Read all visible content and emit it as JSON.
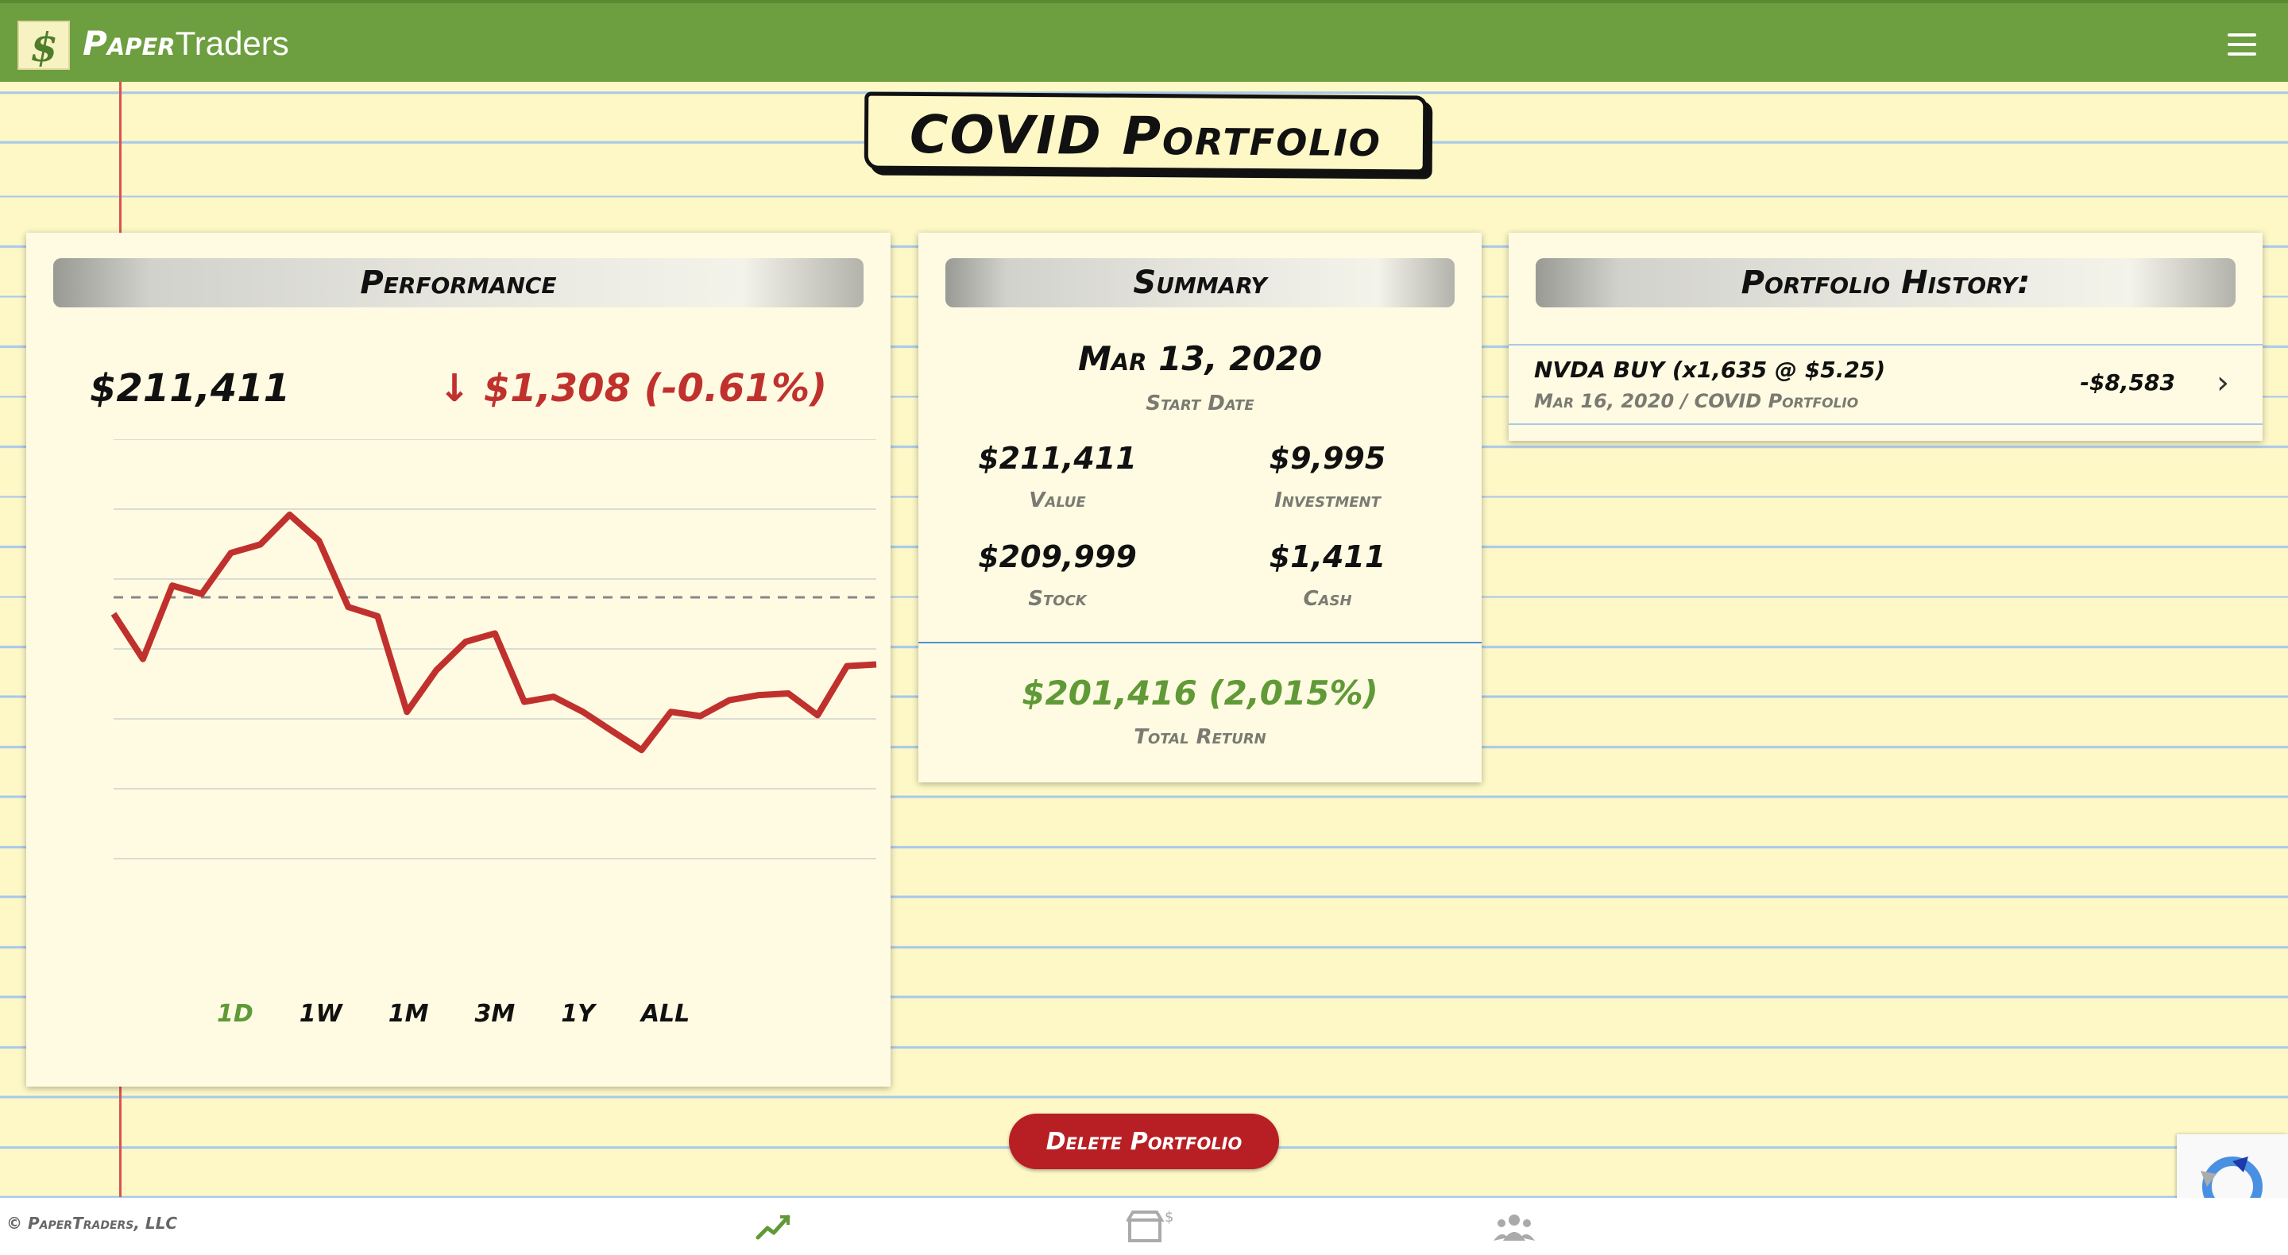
{
  "app": {
    "brand_part1": "Paper",
    "brand_part2": "Traders",
    "logo_glyph": "$",
    "accent_color": "#6d9e3f"
  },
  "page": {
    "title": "COVID Portfolio"
  },
  "performance": {
    "header": "Performance",
    "value": "$211,411",
    "change": "↓ $1,308 (-0.61%)",
    "line_color": "#c0312e",
    "ranges": [
      {
        "label": "1D",
        "active": true
      },
      {
        "label": "1W",
        "active": false
      },
      {
        "label": "1M",
        "active": false
      },
      {
        "label": "3M",
        "active": false
      },
      {
        "label": "1Y",
        "active": false
      },
      {
        "label": "ALL",
        "active": false
      }
    ]
  },
  "chart_data": {
    "type": "line",
    "title": "",
    "xlabel": "",
    "ylabel": "",
    "x": [
      1,
      2,
      3,
      4,
      5,
      6,
      7,
      8,
      9,
      10,
      11,
      12,
      13,
      14,
      15,
      16,
      17,
      18,
      19,
      20,
      21,
      22,
      23,
      24,
      25,
      26
    ],
    "series": [
      {
        "values": [
          58.4,
          47.6,
          65.1,
          63.1,
          72.9,
          74.9,
          82.0,
          75.8,
          60.0,
          57.8,
          35.0,
          44.9,
          51.7,
          53.7,
          37.4,
          38.6,
          35.0,
          30.4,
          25.9,
          35.0,
          34.0,
          37.8,
          39.0,
          39.4,
          34.2,
          45.9,
          46.3
        ]
      }
    ],
    "reference_line": 62.3,
    "ylim": [
      0,
      100
    ],
    "grid": true,
    "legend": "none"
  },
  "summary": {
    "header": "Summary",
    "start_date": "Mar 13, 2020",
    "start_date_label": "Start Date",
    "value": "$211,411",
    "value_label": "Value",
    "investment": "$9,995",
    "investment_label": "Investment",
    "stock": "$209,999",
    "stock_label": "Stock",
    "cash": "$1,411",
    "cash_label": "Cash",
    "total_return": "$201,416 (2,015%)",
    "total_return_label": "Total Return"
  },
  "history": {
    "header": "Portfolio History:",
    "items": [
      {
        "title": "NVDA BUY (x1,635 @ $5.25)",
        "subtitle": "Mar 16, 2020 / COVID Portfolio",
        "amount": "-$8,583"
      }
    ]
  },
  "actions": {
    "delete_label": "Delete Portfolio"
  },
  "footer": {
    "copyright": "© PaperTraders, LLC"
  },
  "icons": [
    "menu-icon",
    "trend-icon",
    "store-icon",
    "users-icon",
    "chevron-right-icon"
  ]
}
